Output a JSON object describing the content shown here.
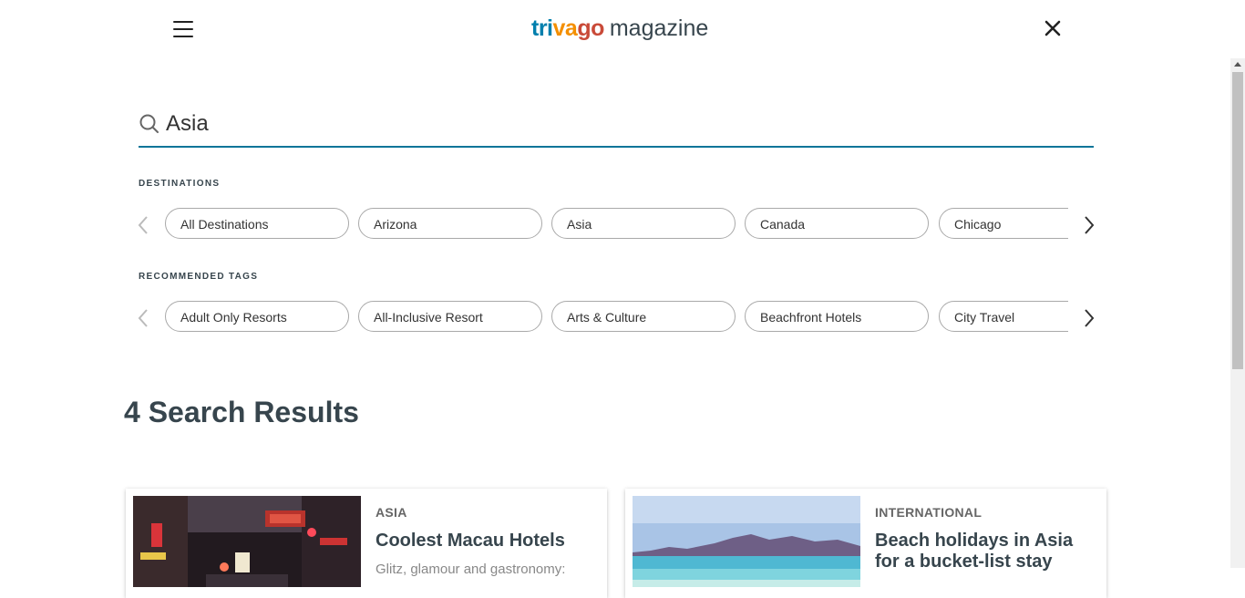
{
  "header": {
    "logo_brand": "trivago",
    "logo_suffix": "magazine"
  },
  "search": {
    "value": "Asia",
    "placeholder": "Search"
  },
  "destinations": {
    "label": "DESTINATIONS",
    "chips": [
      "All Destinations",
      "Arizona",
      "Asia",
      "Canada",
      "Chicago"
    ]
  },
  "tags": {
    "label": "RECOMMENDED TAGS",
    "chips": [
      "Adult Only Resorts",
      "All-Inclusive Resort",
      "Arts & Culture",
      "Beachfront Hotels",
      "City Travel"
    ]
  },
  "results": {
    "title": "4 Search Results",
    "cards": [
      {
        "tag": "ASIA",
        "title": "Coolest Macau Hotels",
        "desc": "Glitz, glamour and gastronomy:"
      },
      {
        "tag": "INTERNATIONAL",
        "title": "Beach holidays in Asia for a bucket-list stay",
        "desc": ""
      }
    ]
  },
  "colors": {
    "accent": "#0a7599",
    "heading": "#37454d",
    "logo_tri": "#007fad",
    "logo_va": "#f48f00",
    "logo_go": "#c94a38"
  },
  "icons": {
    "menu": "hamburger-icon",
    "close": "close-icon",
    "search": "search-icon",
    "prev": "chevron-left-icon",
    "next": "chevron-right-icon"
  }
}
